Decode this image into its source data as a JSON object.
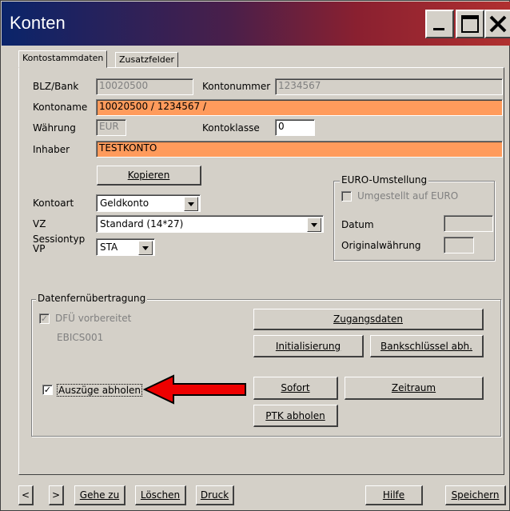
{
  "window": {
    "title": "Konten"
  },
  "tabs": [
    {
      "label": "Kontostammdaten"
    },
    {
      "label": "Zusatzfelder"
    }
  ],
  "form": {
    "blz_label": "BLZ/Bank",
    "blz_value": "10020500",
    "kontonummer_label": "Kontonummer",
    "kontonummer_value": "1234567",
    "kontoname_label": "Kontoname",
    "kontoname_value": "10020500 / 1234567 /",
    "waehrung_label": "Währung",
    "waehrung_value": "EUR",
    "kontoklasse_label": "Kontoklasse",
    "kontoklasse_value": "0",
    "inhaber_label": "Inhaber",
    "inhaber_value": "TESTKONTO",
    "kopieren_label": "Kopieren",
    "kontoart_label": "Kontoart",
    "kontoart_value": "Geldkonto",
    "vz_label": "VZ",
    "vz_value": "Standard (14*27)",
    "sessiontyp_label_1": "Sessiontyp",
    "sessiontyp_label_2": "VP",
    "sessiontyp_value": "STA"
  },
  "euro": {
    "title": "EURO-Umstellung",
    "umgestellt_label": "Umgestellt auf EURO",
    "datum_label": "Datum",
    "originalwaehrung_label": "Originalwährung"
  },
  "dfu": {
    "title": "Datenfernübertragung",
    "vorbereitet_label": "DFÜ vorbereitet",
    "ebics_label": "EBICS001",
    "zugangsdaten_label": "Zugangsdaten",
    "initialisierung_label": "Initialisierung",
    "bankschluessel_label": "Bankschlüssel abh.",
    "auszuege_label": "Auszüge abholen",
    "sofort_label": "Sofort",
    "zeitraum_label": "Zeitraum",
    "ptk_label": "PTK abholen"
  },
  "footer": {
    "prev": "<",
    "next": ">",
    "gehe_zu": "Gehe zu",
    "loeschen": "Löschen",
    "druck": "Druck",
    "hilfe": "Hilfe",
    "speichern": "Speichern"
  },
  "colors": {
    "highlight": "#ff9b5c",
    "arrow": "#ee0000",
    "face": "#d4d0c8"
  },
  "icons": {
    "minimize": "minimize-icon",
    "maximize": "maximize-icon",
    "close": "close-icon",
    "arrow": "red-arrow-annotation"
  }
}
